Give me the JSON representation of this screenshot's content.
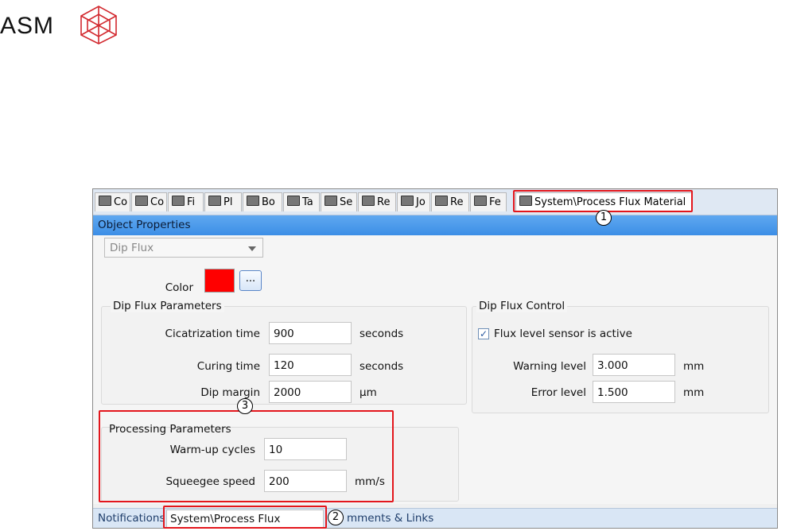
{
  "logo": {
    "text": "ASM"
  },
  "tabs": [
    {
      "label": "Co",
      "icon": "component-icon"
    },
    {
      "label": "Co",
      "icon": "component-shape-icon"
    },
    {
      "label": "Fi",
      "icon": "fiducial-icon"
    },
    {
      "label": "Pl",
      "icon": "placement-icon"
    },
    {
      "label": "Bo",
      "icon": "board-icon"
    },
    {
      "label": "Ta",
      "icon": "table-icon"
    },
    {
      "label": "Se",
      "icon": "setup-icon"
    },
    {
      "label": "Re",
      "icon": "recipe-icon"
    },
    {
      "label": "Jo",
      "icon": "job-icon"
    },
    {
      "label": "Re",
      "icon": "rejected-icon"
    },
    {
      "label": "Fe",
      "icon": "feeder-icon"
    }
  ],
  "active_tab": {
    "label": "System\\Process Flux Material",
    "icon": "process-flux-icon"
  },
  "object_properties": {
    "title": "Object Properties"
  },
  "type_select": {
    "value": "Dip Flux"
  },
  "color": {
    "label": "Color",
    "value": "#ff0000",
    "button_label": "..."
  },
  "dip_flux_parameters": {
    "title": "Dip Flux Parameters",
    "cicatrization_time": {
      "label": "Cicatrization time",
      "value": "900",
      "unit": "seconds"
    },
    "curing_time": {
      "label": "Curing time",
      "value": "120",
      "unit": "seconds"
    },
    "dip_margin": {
      "label": "Dip margin",
      "value": "2000",
      "unit": "µm"
    }
  },
  "dip_flux_control": {
    "title": "Dip Flux Control",
    "sensor": {
      "label": "Flux level sensor is active",
      "checked": true
    },
    "warning_level": {
      "label": "Warning level",
      "value": "3.000",
      "unit": "mm"
    },
    "error_level": {
      "label": "Error level",
      "value": "1.500",
      "unit": "mm"
    }
  },
  "processing_parameters": {
    "title": "Processing Parameters",
    "warmup_cycles": {
      "label": "Warm-up cycles",
      "value": "10"
    },
    "squeegee_speed": {
      "label": "Squeegee speed",
      "value": "200",
      "unit": "mm/s"
    }
  },
  "status_bar": {
    "notifications": "Notifications",
    "tab": "System\\Process Flux Material",
    "comments_links": "mments & Links"
  },
  "callouts": [
    "1",
    "2",
    "3"
  ],
  "colors": {
    "highlight": "#e3161c",
    "header_blue": "#3c8ee6"
  }
}
